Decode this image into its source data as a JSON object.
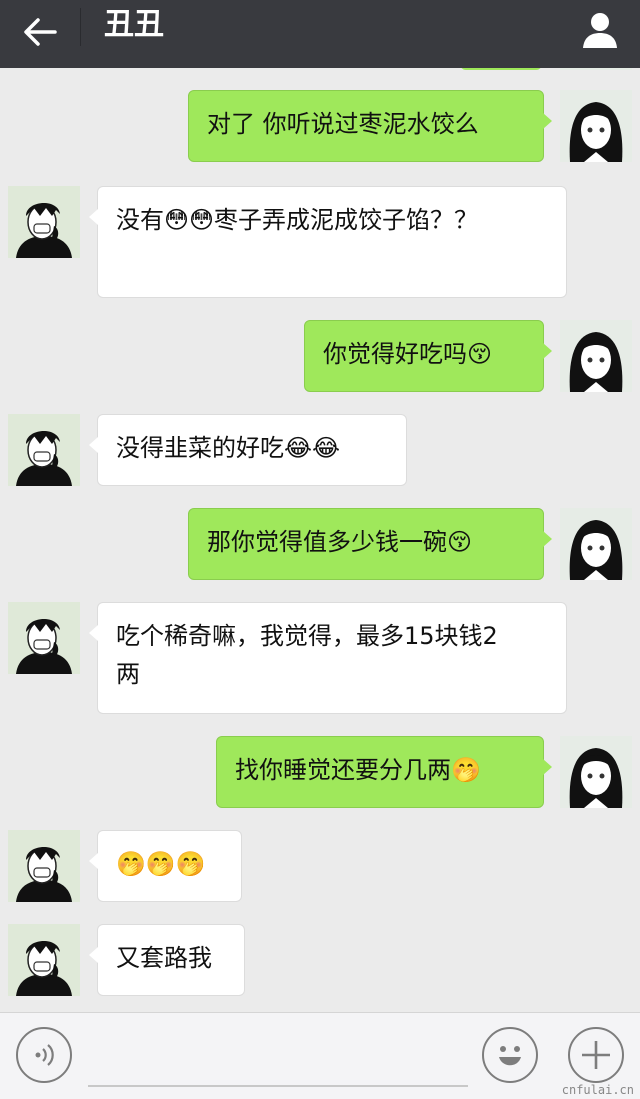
{
  "header": {
    "title": "丑丑",
    "back_icon": "arrow-left-icon",
    "profile_icon": "person-icon"
  },
  "colors": {
    "header_bg": "#393a3f",
    "chat_bg": "#ebebeb",
    "outgoing_bubble": "#9fe85b",
    "incoming_bubble": "#ffffff"
  },
  "messages": [
    {
      "direction": "out",
      "text": "对了 你听说过枣泥水饺么",
      "avatar": "girl-avatar"
    },
    {
      "direction": "in",
      "text": "没有😳😳枣子弄成泥成饺子馅？？",
      "avatar": "boy-avatar"
    },
    {
      "direction": "out",
      "text": "你觉得好吃吗😚",
      "avatar": "girl-avatar"
    },
    {
      "direction": "in",
      "text": "没得韭菜的好吃😂😂",
      "avatar": "boy-avatar"
    },
    {
      "direction": "out",
      "text": "那你觉得值多少钱一碗😚",
      "avatar": "girl-avatar"
    },
    {
      "direction": "in",
      "text": "吃个稀奇嘛，我觉得，最多15块钱2两",
      "avatar": "boy-avatar"
    },
    {
      "direction": "out",
      "text": "找你睡觉还要分几两🤭",
      "avatar": "girl-avatar"
    },
    {
      "direction": "in",
      "text": "🤭🤭🤭",
      "avatar": "boy-avatar"
    },
    {
      "direction": "in",
      "text": "又套路我",
      "avatar": "boy-avatar"
    }
  ],
  "input": {
    "voice_icon": "voice-icon",
    "emoji_icon": "emoji-icon",
    "plus_icon": "plus-icon",
    "value": "",
    "placeholder": ""
  },
  "watermark": "cnfulai.cn"
}
